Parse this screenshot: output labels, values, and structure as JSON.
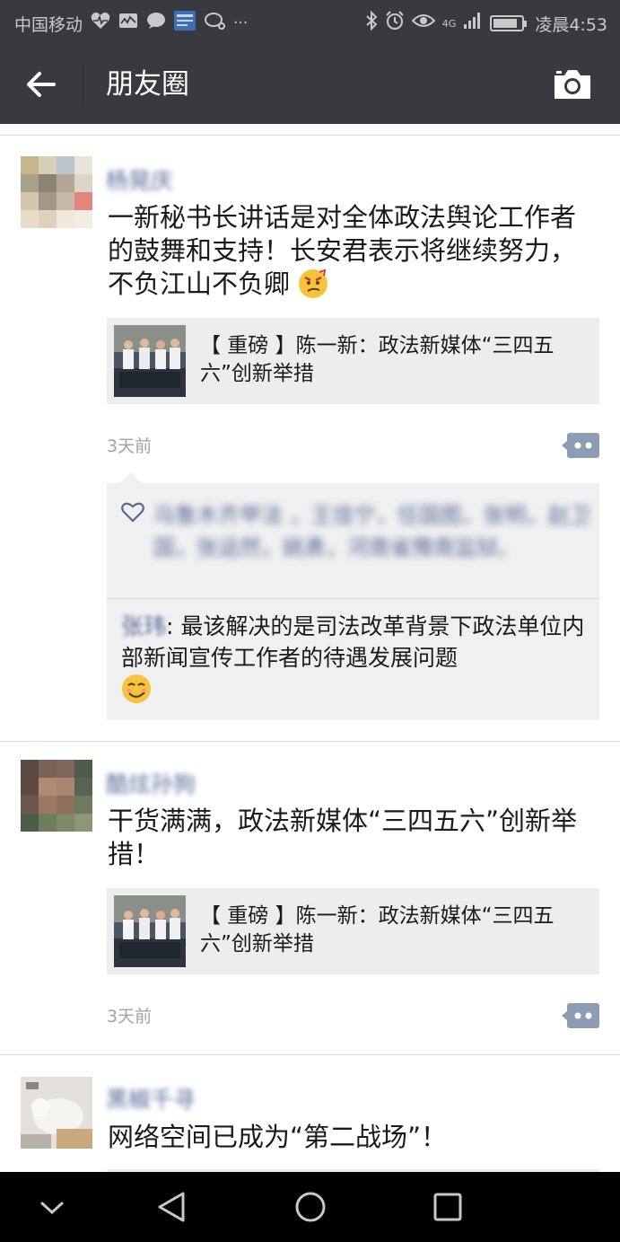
{
  "status_bar": {
    "carrier": "中国移动",
    "network": "4G",
    "time": "凌晨4:53",
    "battery_level": 0.85,
    "left_icons": [
      "heart-rate-icon",
      "activity-icon",
      "chat-bubble-icon",
      "news-app-icon",
      "message-icon",
      "more-dots-icon"
    ],
    "right_icons": [
      "bluetooth-icon",
      "alarm-icon",
      "eye-comfort-icon",
      "signal-icon",
      "battery-icon"
    ],
    "more_label": "···"
  },
  "title_bar": {
    "title": "朋友圈",
    "back_icon": "back-arrow-icon",
    "camera_icon": "camera-icon"
  },
  "posts": [
    {
      "username": "杨晃庆",
      "text": "一新秘书长讲话是对全体政法舆论工作者的鼓舞和支持！长安君表示将继续努力，不负江山不负卿",
      "text_emoji": "angry-smirk-emoji",
      "link": {
        "title": "【 重磅 】陈一新：政法新媒体“三四五六”创新举措"
      },
      "time_ago": "3天前",
      "likes": "乌鲁木齐甲法 ，王佳宁，任国图，张明，赵卫国，张运然，姚勇，河南省豫南监狱、",
      "comments": [
        {
          "name": "张玮",
          "text": ": 最该解决的是司法改革背景下政法单位内部新闻宣传工作者的待遇发展问题",
          "emoji": "smirk-emoji"
        }
      ]
    },
    {
      "username": "酷炫孙狗",
      "text": "干货满满，政法新媒体“三四五六”创新举措！",
      "link": {
        "title": "【 重磅 】陈一新：政法新媒体“三四五六”创新举措"
      },
      "time_ago": "3天前"
    },
    {
      "username": "黑椒千寻",
      "text": "网络空间已成为“第二战场”！"
    }
  ],
  "nav_bar": {
    "icons": [
      "collapse-chevron-icon",
      "back-triangle-icon",
      "home-circle-icon",
      "recents-square-icon"
    ]
  }
}
